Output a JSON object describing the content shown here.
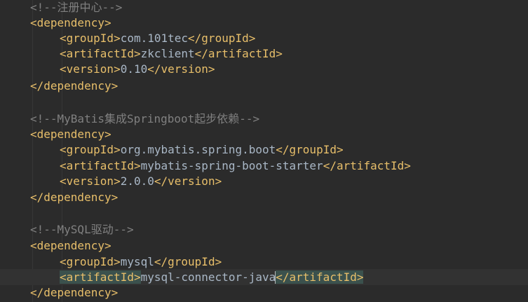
{
  "editor": {
    "lines": [
      {
        "comment": "<!--注册中心-->"
      },
      {
        "open": "<dependency>"
      },
      {
        "open": "<groupId>",
        "text": "com.101tec",
        "close": "</groupId>"
      },
      {
        "open": "<artifactId>",
        "text": "zkclient",
        "close": "</artifactId>"
      },
      {
        "open": "<version>",
        "text": "0.10",
        "close": "</version>"
      },
      {
        "close": "</dependency>"
      },
      {},
      {
        "comment": "<!--MyBatis集成Springboot起步依赖-->"
      },
      {
        "open": "<dependency>"
      },
      {
        "open": "<groupId>",
        "text": "org.mybatis.spring.boot",
        "close": "</groupId>"
      },
      {
        "open": "<artifactId>",
        "text": "mybatis-spring-boot-starter",
        "close": "</artifactId>"
      },
      {
        "open": "<version>",
        "text": "2.0.0",
        "close": "</version>"
      },
      {
        "close": "</dependency>"
      },
      {},
      {
        "comment": "<!--MySQL驱动-->"
      },
      {
        "open": "<dependency>"
      },
      {
        "open": "<groupId>",
        "text": "mysql",
        "close": "</groupId>"
      },
      {
        "open": "<artifactId>",
        "text": "mysql-connector-java",
        "close": "</artifactId>"
      },
      {
        "close": "</dependency>"
      }
    ],
    "colors": {
      "background": "#2b2b2b",
      "comment": "#808080",
      "tag": "#e8bf6a",
      "text": "#a9b7c6",
      "tag_match_highlight": "#3b514d",
      "current_line": "#323232"
    }
  }
}
